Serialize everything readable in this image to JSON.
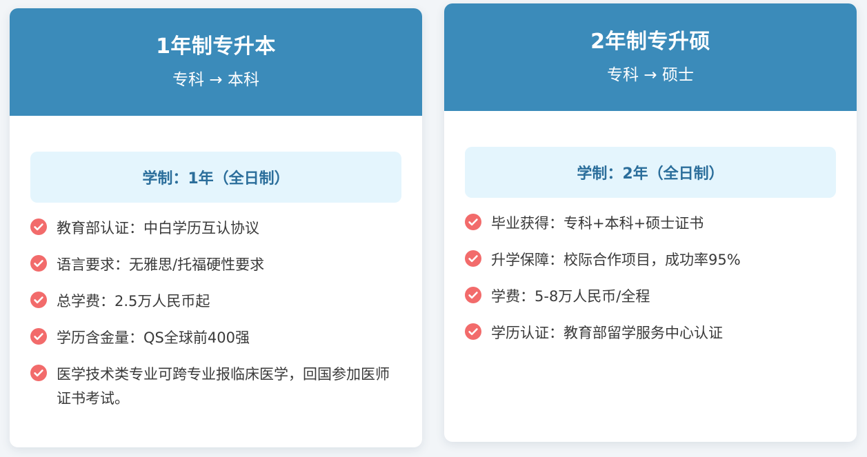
{
  "colors": {
    "header_bg": "#3b8bba",
    "duration_bg": "#e4f5fd",
    "duration_text": "#2b6e9b",
    "check": "#f26b6b",
    "page_bg": "#f2f5f8"
  },
  "cards": [
    {
      "title": "1年制专升本",
      "subtitle": "专科 → 本科",
      "duration": "学制：1年（全日制）",
      "features": [
        "教育部认证：中白学历互认协议",
        "语言要求：无雅思/托福硬性要求",
        "总学费：2.5万人民币起",
        "学历含金量：QS全球前400强",
        "医学技术类专业可跨专业报临床医学，回国参加医师证书考试。"
      ]
    },
    {
      "title": "2年制专升硕",
      "subtitle": "专科 → 硕士",
      "duration": "学制：2年（全日制）",
      "features": [
        "毕业获得：专科+本科+硕士证书",
        "升学保障：校际合作项目，成功率95%",
        "学费：5-8万人民币/全程",
        "学历认证：教育部留学服务中心认证"
      ]
    }
  ]
}
